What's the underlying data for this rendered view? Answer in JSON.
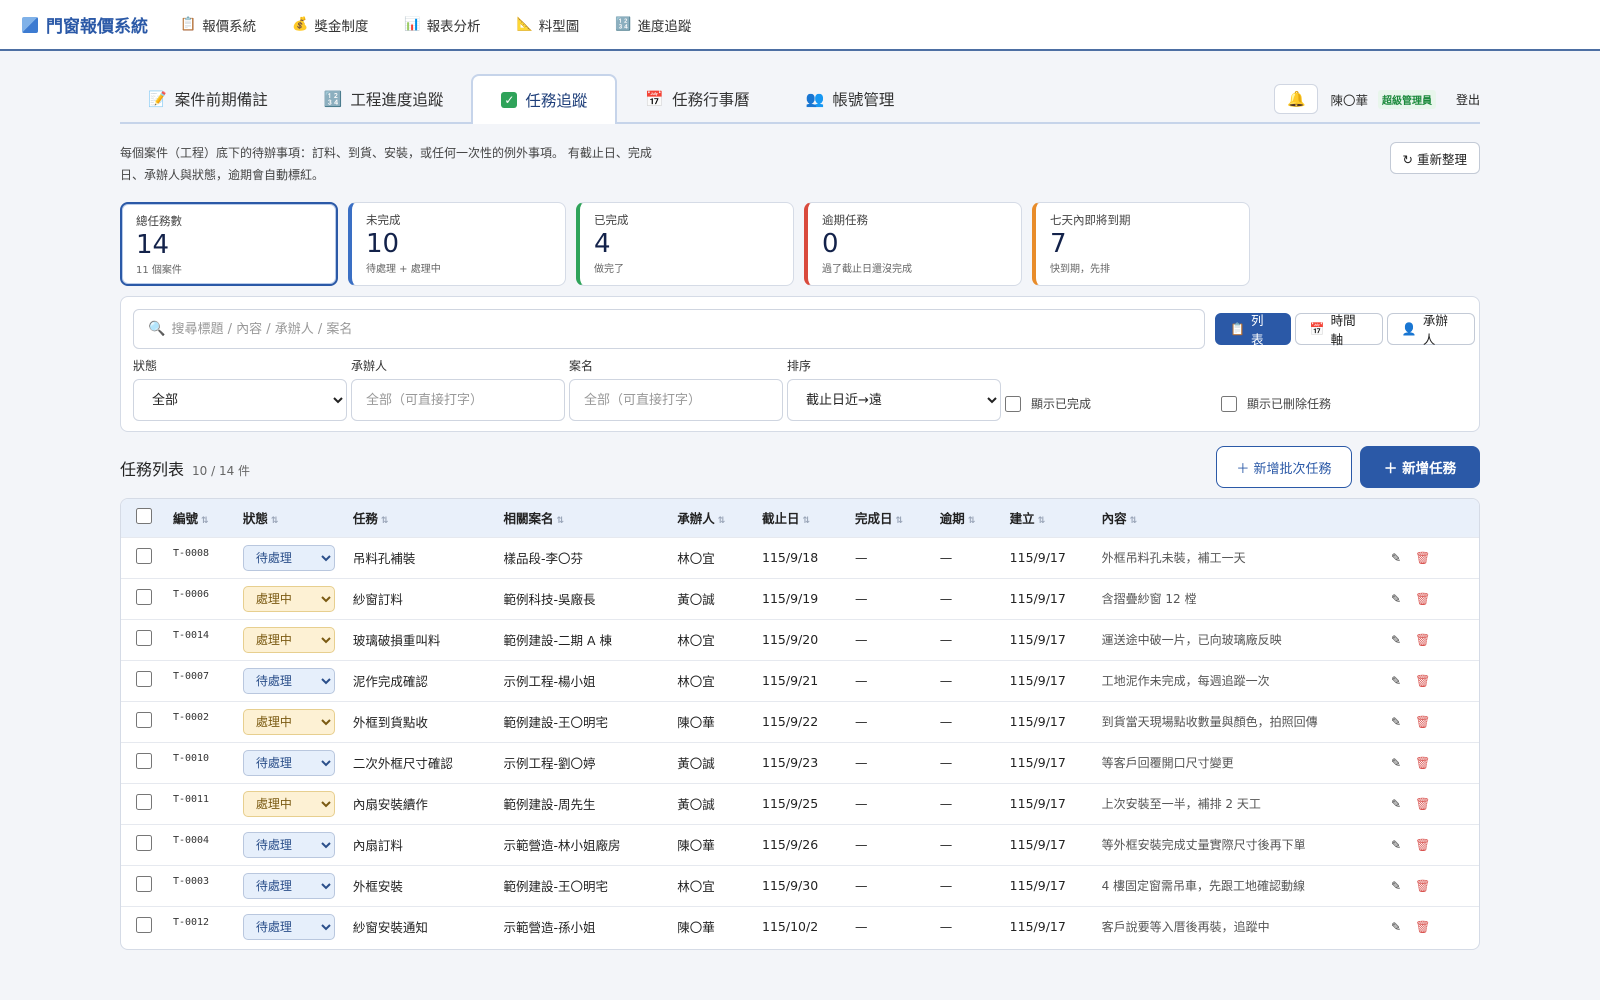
{
  "app": {
    "title": "門窗報價系統"
  },
  "nav": [
    {
      "label": "報價系統",
      "icon": "📋"
    },
    {
      "label": "獎金制度",
      "icon": "💰"
    },
    {
      "label": "報表分析",
      "icon": "📊"
    },
    {
      "label": "料型圖",
      "icon": "📐"
    },
    {
      "label": "進度追蹤",
      "icon": "🔢"
    }
  ],
  "tabs": [
    {
      "label": "案件前期備註",
      "icon": "📝"
    },
    {
      "label": "工程進度追蹤",
      "icon": "🔢"
    },
    {
      "label": "任務追蹤",
      "icon": "✓"
    },
    {
      "label": "任務行事曆",
      "icon": "📅"
    },
    {
      "label": "帳號管理",
      "icon": "👥"
    }
  ],
  "user": {
    "name": "陳〇華",
    "role": "超級管理員",
    "logout": "登出"
  },
  "intro": "每個案件（工程）底下的待辦事項：訂料、到貨、安裝，或任何一次性的例外事項。 有截止日、完成日、承辦人與狀態，逾期會自動標紅。",
  "refresh_label": "↻ 重新整理",
  "stats": [
    {
      "label": "總任務數",
      "value": "14",
      "sub": "11 個案件"
    },
    {
      "label": "未完成",
      "value": "10",
      "sub": "待處理 + 處理中"
    },
    {
      "label": "已完成",
      "value": "4",
      "sub": "做完了"
    },
    {
      "label": "逾期任務",
      "value": "0",
      "sub": "過了截止日還沒完成"
    },
    {
      "label": "七天內即將到期",
      "value": "7",
      "sub": "快到期，先排"
    }
  ],
  "filter": {
    "search_placeholder": "搜尋標題 / 內容 / 承辦人 / 案名",
    "views": [
      {
        "label": "列表",
        "icon": "📋"
      },
      {
        "label": "時間軸",
        "icon": "📅"
      },
      {
        "label": "承辦人",
        "icon": "👤"
      }
    ],
    "status_label": "狀態",
    "status_value": "全部",
    "owner_label": "承辦人",
    "owner_placeholder": "全部（可直接打字）",
    "case_label": "案名",
    "case_placeholder": "全部（可直接打字）",
    "sort_label": "排序",
    "sort_value": "截止日近→遠",
    "show_done": "顯示已完成",
    "show_deleted": "顯示已刪除任務"
  },
  "list": {
    "title": "任務列表",
    "count": "10 / 14 件",
    "batch_label": "＋ 新增批次任務",
    "new_label": "＋ 新增任務"
  },
  "columns": [
    "編號",
    "狀態",
    "任務",
    "相關案名",
    "承辦人",
    "截止日",
    "完成日",
    "逾期",
    "建立",
    "內容"
  ],
  "rows": [
    {
      "id": "T-0008",
      "status": "待處理",
      "task": "吊料孔補裝",
      "case": "樣品段-李〇芬",
      "owner": "林〇宜",
      "due": "115/9/18",
      "done": "—",
      "overdue": "—",
      "created": "115/9/17",
      "content": "外框吊料孔未裝，補工一天"
    },
    {
      "id": "T-0006",
      "status": "處理中",
      "task": "紗窗訂料",
      "case": "範例科技-吳廠長",
      "owner": "黃〇誠",
      "due": "115/9/19",
      "done": "—",
      "overdue": "—",
      "created": "115/9/17",
      "content": "含摺疊紗窗 12 樘"
    },
    {
      "id": "T-0014",
      "status": "處理中",
      "task": "玻璃破損重叫料",
      "case": "範例建設-二期 A 棟",
      "owner": "林〇宜",
      "due": "115/9/20",
      "done": "—",
      "overdue": "—",
      "created": "115/9/17",
      "content": "運送途中破一片，已向玻璃廠反映"
    },
    {
      "id": "T-0007",
      "status": "待處理",
      "task": "泥作完成確認",
      "case": "示例工程-楊小姐",
      "owner": "林〇宜",
      "due": "115/9/21",
      "done": "—",
      "overdue": "—",
      "created": "115/9/17",
      "content": "工地泥作未完成，每週追蹤一次"
    },
    {
      "id": "T-0002",
      "status": "處理中",
      "task": "外框到貨點收",
      "case": "範例建設-王〇明宅",
      "owner": "陳〇華",
      "due": "115/9/22",
      "done": "—",
      "overdue": "—",
      "created": "115/9/17",
      "content": "到貨當天現場點收數量與顏色，拍照回傳"
    },
    {
      "id": "T-0010",
      "status": "待處理",
      "task": "二次外框尺寸確認",
      "case": "示例工程-劉〇婷",
      "owner": "黃〇誠",
      "due": "115/9/23",
      "done": "—",
      "overdue": "—",
      "created": "115/9/17",
      "content": "等客戶回覆開口尺寸變更"
    },
    {
      "id": "T-0011",
      "status": "處理中",
      "task": "內扇安裝續作",
      "case": "範例建設-周先生",
      "owner": "黃〇誠",
      "due": "115/9/25",
      "done": "—",
      "overdue": "—",
      "created": "115/9/17",
      "content": "上次安裝至一半，補排 2 天工"
    },
    {
      "id": "T-0004",
      "status": "待處理",
      "task": "內扇訂料",
      "case": "示範營造-林小姐廠房",
      "owner": "陳〇華",
      "due": "115/9/26",
      "done": "—",
      "overdue": "—",
      "created": "115/9/17",
      "content": "等外框安裝完成丈量實際尺寸後再下單"
    },
    {
      "id": "T-0003",
      "status": "待處理",
      "task": "外框安裝",
      "case": "範例建設-王〇明宅",
      "owner": "林〇宜",
      "due": "115/9/30",
      "done": "—",
      "overdue": "—",
      "created": "115/9/17",
      "content": "4 樓固定窗需吊車，先跟工地確認動線"
    },
    {
      "id": "T-0012",
      "status": "待處理",
      "task": "紗窗安裝通知",
      "case": "示範營造-孫小姐",
      "owner": "陳〇華",
      "due": "115/10/2",
      "done": "—",
      "overdue": "—",
      "created": "115/9/17",
      "content": "客戶說要等入厝後再裝，追蹤中"
    }
  ]
}
